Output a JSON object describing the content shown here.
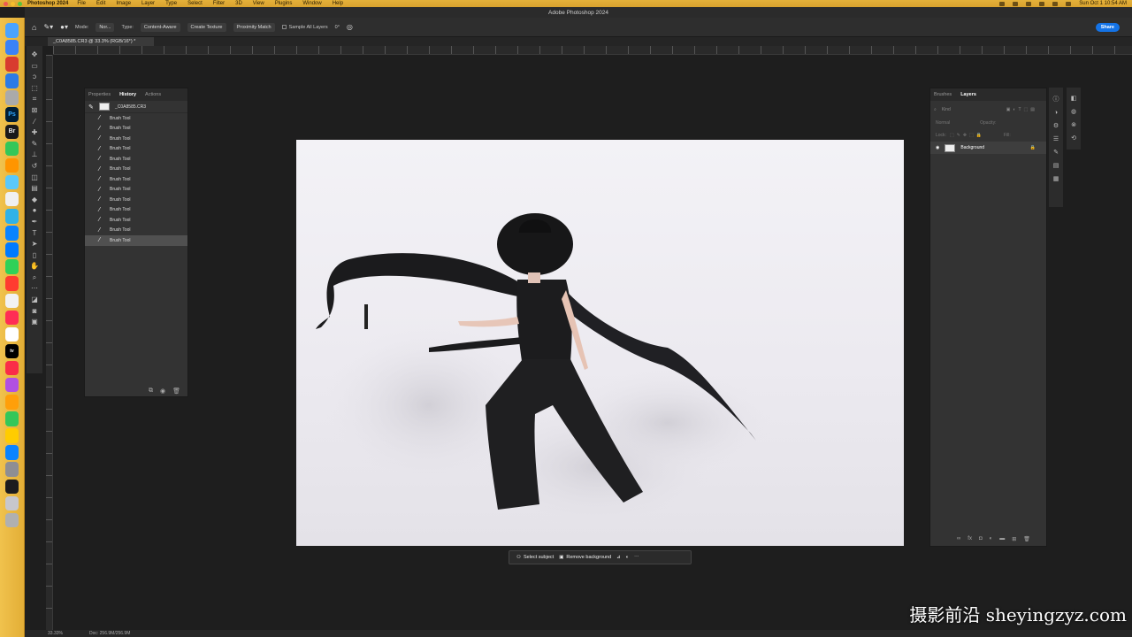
{
  "menubar": {
    "app": "Photoshop 2024",
    "items": [
      "File",
      "Edit",
      "Image",
      "Layer",
      "Type",
      "Select",
      "Filter",
      "3D",
      "View",
      "Plugins",
      "Window",
      "Help"
    ],
    "clock": "Sun Oct 1 10:54 AM"
  },
  "window": {
    "title": "Adobe Photoshop 2024"
  },
  "options": {
    "mode_label": "Mode:",
    "mode_value": "Nor...",
    "type_label": "Type:",
    "type_options": [
      "Content-Aware",
      "Create Texture",
      "Proximity Match"
    ],
    "sample_all": "Sample All Layers",
    "angle": "0°",
    "share_label": "Share"
  },
  "doc_tab": "_C0A8585.CR3 @ 33.3% (RGB/16*) *",
  "history_panel": {
    "tabs": [
      "Properties",
      "History",
      "Actions"
    ],
    "active_tab": "History",
    "snapshot": "_C0A8585.CR3",
    "items": [
      "Brush Tool",
      "Brush Tool",
      "Brush Tool",
      "Brush Tool",
      "Brush Tool",
      "Brush Tool",
      "Brush Tool",
      "Brush Tool",
      "Brush Tool",
      "Brush Tool",
      "Brush Tool",
      "Brush Tool",
      "Brush Tool"
    ],
    "selected_index": 12
  },
  "context_bar": {
    "select_subject": "Select subject",
    "remove_background": "Remove background"
  },
  "layers_panel": {
    "tabs": [
      "Brushes",
      "Layers"
    ],
    "active_tab": "Layers",
    "search_placeholder": "Kind",
    "blend_mode": "Normal",
    "opacity_label": "Opacity:",
    "lock_label": "Lock:",
    "fill_label": "Fill:",
    "layers": [
      {
        "name": "Background",
        "locked": true,
        "visible": true
      }
    ]
  },
  "status": {
    "zoom": "33.33%",
    "doc_size": "Doc: 256.9M/256.9M"
  },
  "watermark": "摄影前沿 sheyingzyz.com"
}
